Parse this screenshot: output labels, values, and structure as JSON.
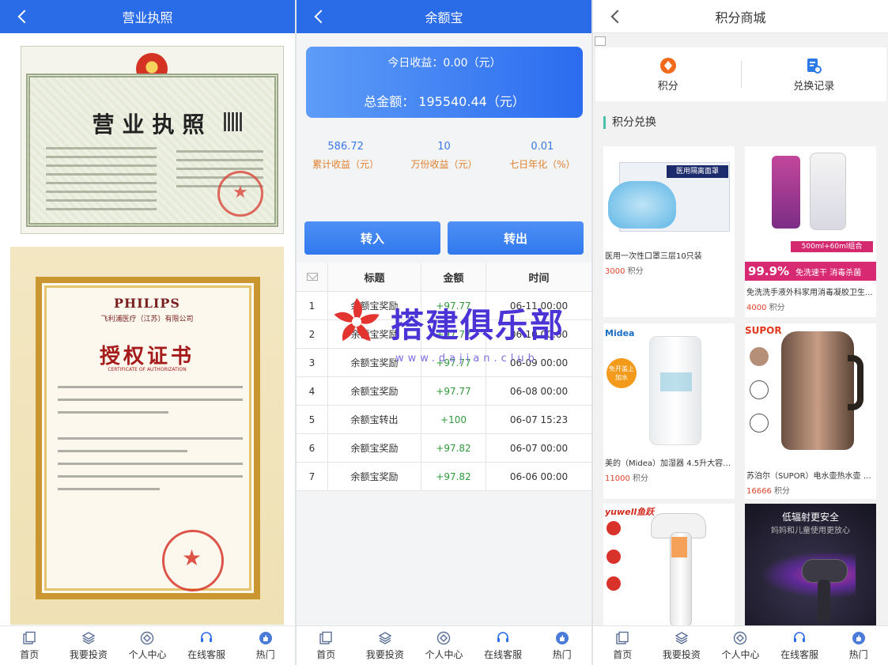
{
  "panel1": {
    "title": "营业执照",
    "cert1": {
      "title": "营业执照"
    },
    "cert2": {
      "brand": "PHILIPS",
      "company": "飞利浦医疗（江苏）有限公司",
      "title": "授权证书",
      "en": "CERTIFICATE OF AUTHORIZATION"
    }
  },
  "panel2": {
    "title": "余额宝",
    "today_income": "今日收益：0.00（元）",
    "total_amount": "总金额： 195540.44（元）",
    "stats": [
      {
        "value": "586.72",
        "label": "累计收益（元）"
      },
      {
        "value": "10",
        "label": "万份收益（元）"
      },
      {
        "value": "0.01",
        "label": "七日年化（%）"
      }
    ],
    "transfer_in": "转入",
    "transfer_out": "转出",
    "table": {
      "headers": [
        "标题",
        "金额",
        "时间"
      ],
      "rows": [
        {
          "n": "1",
          "title": "余额宝奖励",
          "amount": "+97.77",
          "time": "06-11 00:00"
        },
        {
          "n": "2",
          "title": "余额宝奖励",
          "amount": "+97.77",
          "time": "06-10 00:00"
        },
        {
          "n": "3",
          "title": "余额宝奖励",
          "amount": "+97.77",
          "time": "06-09 00:00"
        },
        {
          "n": "4",
          "title": "余额宝奖励",
          "amount": "+97.77",
          "time": "06-08 00:00"
        },
        {
          "n": "5",
          "title": "余额宝转出",
          "amount": "+100",
          "time": "06-07 15:23"
        },
        {
          "n": "6",
          "title": "余额宝奖励",
          "amount": "+97.82",
          "time": "06-07 00:00"
        },
        {
          "n": "7",
          "title": "余额宝奖励",
          "amount": "+97.82",
          "time": "06-06 00:00"
        }
      ]
    }
  },
  "watermark": {
    "text": "搭建俱乐部",
    "url": "www.dajian.club"
  },
  "panel3": {
    "title": "积分商城",
    "menu": {
      "points": "积分",
      "records": "兑换记录"
    },
    "section": "积分兑换",
    "products": [
      {
        "name": "医用一次性口罩三层10只装",
        "points": "3000",
        "unit": "积分",
        "img_text": "医用隔离面罩"
      },
      {
        "name": "免洗洗手液外科家用消毒凝胶卫生...",
        "points": "4000",
        "unit": "积分",
        "img_text": "500ml+60ml组合",
        "badge": "99.9%",
        "badge2": "免洗速干 消毒杀菌"
      },
      {
        "name": "美的（Midea）加湿器 4.5升大容量 ...",
        "points": "11000",
        "unit": "积分",
        "img_text": "Midea",
        "badge": "免开盖上加水"
      },
      {
        "name": "苏泊尔（SUPOR）电水壶热水壶 1....",
        "points": "16666",
        "unit": "积分",
        "img_text": "SUPOR"
      },
      {
        "name": "",
        "points": "",
        "unit": "",
        "img_text": "yuwell鱼跃"
      },
      {
        "name": "",
        "points": "",
        "unit": "",
        "img_text": "低辐射更安全",
        "img_sub": "妈妈和儿童使用更放心"
      }
    ]
  },
  "tabs": [
    "首页",
    "我要投资",
    "个人中心",
    "在线客服",
    "热门"
  ],
  "colors": {
    "primary": "#2a6be8",
    "green": "#2e9a3c",
    "orange": "#e07f2e",
    "red": "#e0422a"
  }
}
